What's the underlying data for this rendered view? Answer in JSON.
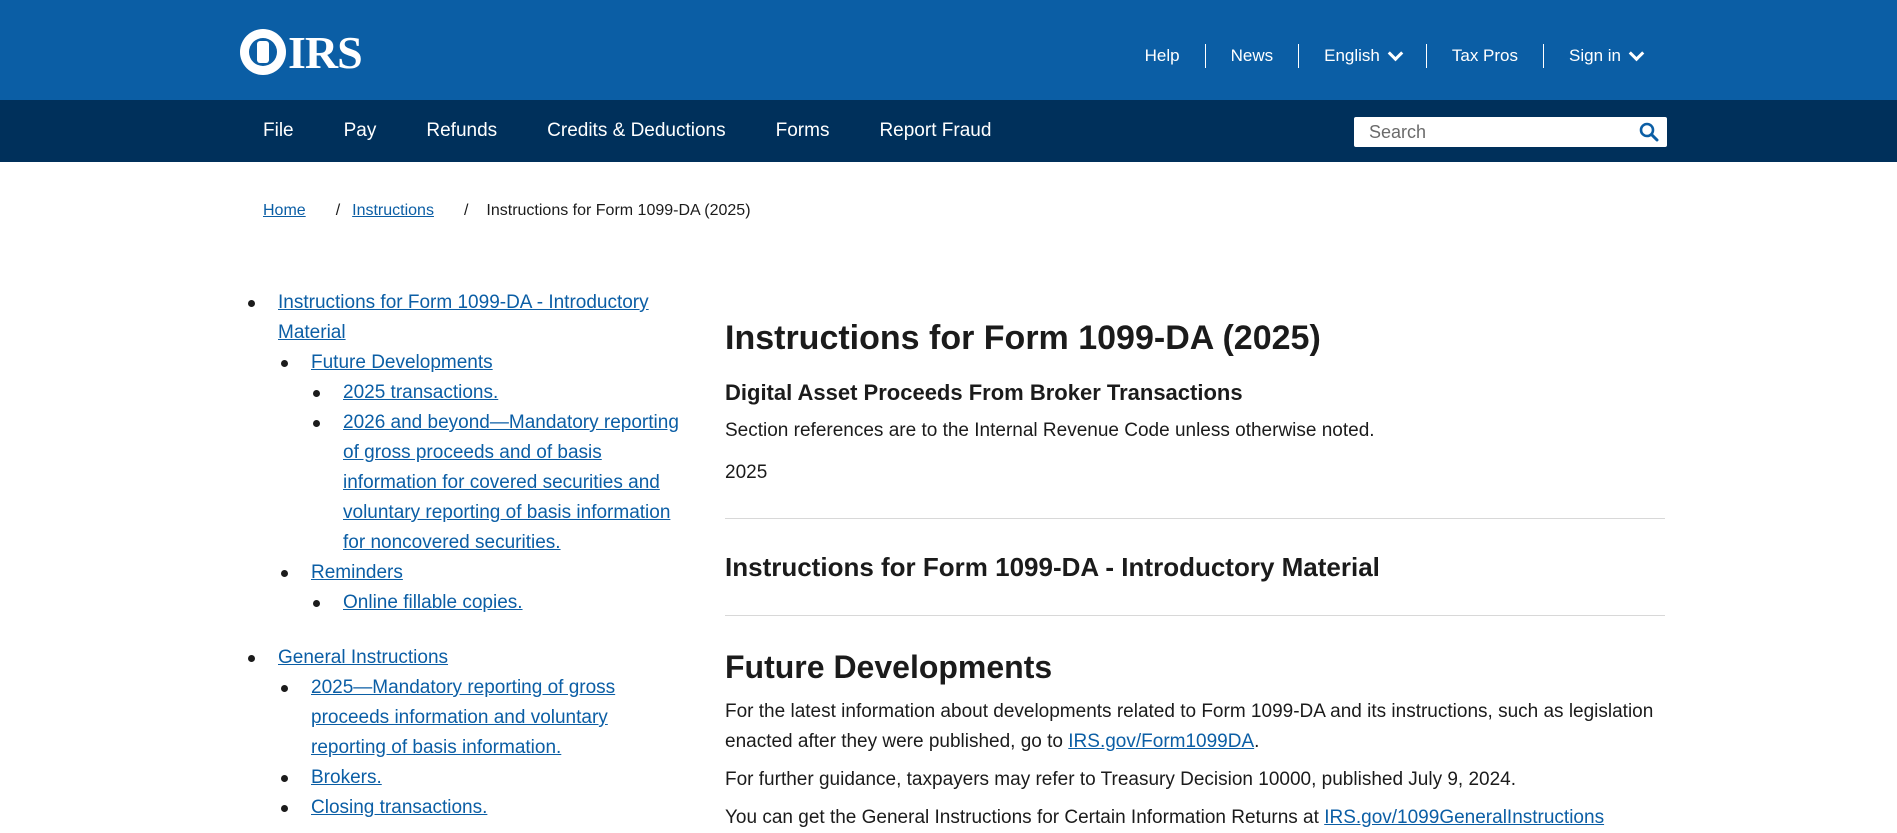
{
  "header": {
    "logo_text": "IRS",
    "util_nav": [
      {
        "label": "Help"
      },
      {
        "label": "News"
      },
      {
        "label": "English"
      },
      {
        "label": "Tax Pros"
      },
      {
        "label": "Sign in"
      }
    ]
  },
  "mainnav": {
    "items": [
      "File",
      "Pay",
      "Refunds",
      "Credits & Deductions",
      "Forms",
      "Report Fraud"
    ],
    "search_placeholder": "Search"
  },
  "breadcrumb": {
    "home": "Home",
    "instructions": "Instructions",
    "separator": "/",
    "current": "Instructions for Form 1099-DA (2025)"
  },
  "toc": {
    "items": [
      "Instructions for Form 1099-DA - Introductory Material",
      "Future Developments",
      "2025 transactions.",
      "2026 and beyond—Mandatory reporting of gross proceeds and of basis information for covered securities and voluntary reporting of basis information for noncovered securities.",
      "Reminders",
      "Online fillable copies.",
      "General Instructions",
      "2025—Mandatory reporting of gross proceeds information and voluntary reporting of basis information.",
      "Brokers.",
      "Closing transactions."
    ]
  },
  "content": {
    "title": "Instructions for Form 1099-DA (2025)",
    "subtitle": "Digital Asset Proceeds From Broker Transactions",
    "section_refs": "Section references are to the Internal Revenue Code unless otherwise noted.",
    "year": "2025",
    "intro_heading": "Instructions for Form 1099-DA - Introductory Material",
    "future_heading": "Future Developments",
    "future_para_before": "For the latest information about developments related to Form 1099-DA and its instructions, such as legislation enacted after they were published, go to ",
    "future_link": "IRS.gov/Form1099DA",
    "future_para_after": ".",
    "guidance_para": "For further guidance, taxpayers may refer to Treasury Decision 10000, published July 9, 2024.",
    "general_para_before": "You can get the General Instructions for Certain Information Returns at ",
    "general_link": "IRS.gov/1099GeneralInstructions"
  }
}
